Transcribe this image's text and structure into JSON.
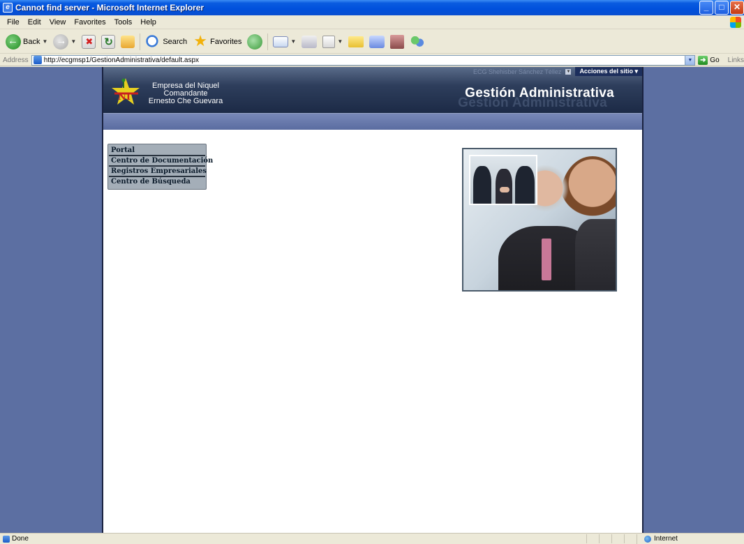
{
  "window": {
    "title": "Cannot find server - Microsoft Internet Explorer",
    "controls": [
      "minimize",
      "maximize",
      "close"
    ]
  },
  "menu": [
    "File",
    "Edit",
    "View",
    "Favorites",
    "Tools",
    "Help"
  ],
  "toolbar": {
    "back_label": "Back",
    "search_label": "Search",
    "favorites_label": "Favorites"
  },
  "address": {
    "label": "Address",
    "url": "http://ecgmsp1/GestionAdministrativa/default.aspx",
    "go_label": "Go",
    "links_label": "Links"
  },
  "site": {
    "user_name": "ECG Shehisber Sánchez Téllez",
    "site_actions": "Acciones del sitio",
    "logo_line1": "Empresa del Niquel",
    "logo_line2": "Comandante",
    "logo_line3": "Ernesto Che Guevara",
    "title": "Gestión Administrativa"
  },
  "nav": [
    {
      "label": "Portal"
    },
    {
      "label": "Centro de Documentación"
    },
    {
      "label": "Registros Empresariales"
    },
    {
      "label": "Centro de Búsqueda"
    }
  ],
  "status": {
    "text": "Done",
    "zone": "Internet"
  },
  "colors": {
    "xp_blue": "#0050dc",
    "page_bg": "#5c6fa2",
    "header_dark": "#1c2a46"
  }
}
